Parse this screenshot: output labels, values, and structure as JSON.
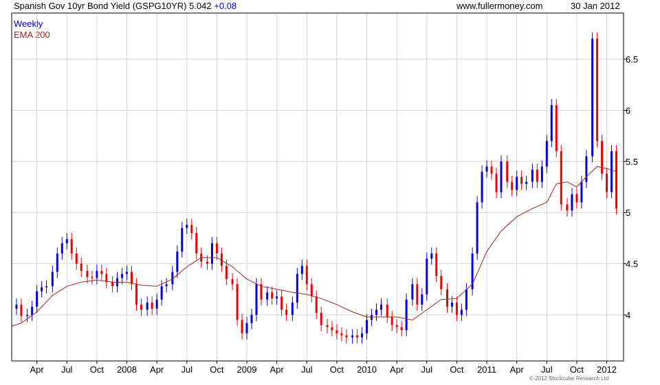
{
  "header": {
    "title": "Spanish Gov 10yr Bond Yield (GSPG10YR) 5.042",
    "change": "+0.08",
    "site": "www.fullermoney.com",
    "date": "30 Jan 2012"
  },
  "legend": {
    "series1": "Weekly",
    "series2": "EMA 200"
  },
  "copyright": "© 2012 Stockcube Research Ltd",
  "colors": {
    "up": "#0000dd",
    "down": "#ee0000",
    "ema": "#aa2222",
    "grid": "#d4d4d4",
    "frame": "#000000"
  },
  "chart_data": {
    "type": "candlestick-bar",
    "title": "Spanish Gov 10yr Bond Yield (GSPG10YR) 5.042 +0.08",
    "xlabel": "",
    "ylabel": "",
    "ylim": [
      3.55,
      6.95
    ],
    "y_ticks": [
      4,
      4.5,
      5,
      5.5,
      6,
      6.5
    ],
    "y_tick_labels": [
      "4",
      "4.5",
      "5",
      "5.5",
      "6",
      "6.5"
    ],
    "x_ticks": [
      {
        "label": "Apr",
        "t": 2007.25
      },
      {
        "label": "Jul",
        "t": 2007.5
      },
      {
        "label": "Oct",
        "t": 2007.75
      },
      {
        "label": "2008",
        "t": 2008.0
      },
      {
        "label": "Apr",
        "t": 2008.25
      },
      {
        "label": "Jul",
        "t": 2008.5
      },
      {
        "label": "Oct",
        "t": 2008.75
      },
      {
        "label": "2009",
        "t": 2009.0
      },
      {
        "label": "Apr",
        "t": 2009.25
      },
      {
        "label": "Jul",
        "t": 2009.5
      },
      {
        "label": "Oct",
        "t": 2009.75
      },
      {
        "label": "2010",
        "t": 2010.0
      },
      {
        "label": "Apr",
        "t": 2010.25
      },
      {
        "label": "Jul",
        "t": 2010.5
      },
      {
        "label": "Oct",
        "t": 2010.75
      },
      {
        "label": "2011",
        "t": 2011.0
      },
      {
        "label": "Apr",
        "t": 2011.25
      },
      {
        "label": "Jul",
        "t": 2011.5
      },
      {
        "label": "Oct",
        "t": 2011.75
      },
      {
        "label": "2012",
        "t": 2012.0
      }
    ],
    "xlim": [
      2007.04,
      2012.14
    ],
    "weekly_close": [
      [
        2007.08,
        4.1
      ],
      [
        2007.12,
        3.99
      ],
      [
        2007.17,
        4.0
      ],
      [
        2007.21,
        4.08
      ],
      [
        2007.25,
        4.23
      ],
      [
        2007.29,
        4.27
      ],
      [
        2007.33,
        4.28
      ],
      [
        2007.38,
        4.42
      ],
      [
        2007.42,
        4.6
      ],
      [
        2007.46,
        4.7
      ],
      [
        2007.5,
        4.74
      ],
      [
        2007.54,
        4.6
      ],
      [
        2007.58,
        4.5
      ],
      [
        2007.62,
        4.43
      ],
      [
        2007.67,
        4.37
      ],
      [
        2007.71,
        4.36
      ],
      [
        2007.75,
        4.43
      ],
      [
        2007.79,
        4.4
      ],
      [
        2007.83,
        4.32
      ],
      [
        2007.88,
        4.28
      ],
      [
        2007.92,
        4.36
      ],
      [
        2007.96,
        4.4
      ],
      [
        2008.0,
        4.42
      ],
      [
        2008.04,
        4.3
      ],
      [
        2008.08,
        4.1
      ],
      [
        2008.12,
        4.05
      ],
      [
        2008.17,
        4.12
      ],
      [
        2008.21,
        4.06
      ],
      [
        2008.25,
        4.15
      ],
      [
        2008.29,
        4.28
      ],
      [
        2008.33,
        4.3
      ],
      [
        2008.38,
        4.42
      ],
      [
        2008.42,
        4.62
      ],
      [
        2008.46,
        4.85
      ],
      [
        2008.5,
        4.88
      ],
      [
        2008.54,
        4.8
      ],
      [
        2008.58,
        4.6
      ],
      [
        2008.62,
        4.52
      ],
      [
        2008.67,
        4.5
      ],
      [
        2008.71,
        4.7
      ],
      [
        2008.75,
        4.6
      ],
      [
        2008.79,
        4.48
      ],
      [
        2008.83,
        4.35
      ],
      [
        2008.88,
        4.3
      ],
      [
        2008.92,
        3.95
      ],
      [
        2008.96,
        3.82
      ],
      [
        2009.0,
        3.92
      ],
      [
        2009.04,
        4.0
      ],
      [
        2009.08,
        4.3
      ],
      [
        2009.12,
        4.15
      ],
      [
        2009.17,
        4.22
      ],
      [
        2009.21,
        4.16
      ],
      [
        2009.25,
        4.18
      ],
      [
        2009.29,
        4.05
      ],
      [
        2009.33,
        4.0
      ],
      [
        2009.38,
        4.12
      ],
      [
        2009.42,
        4.4
      ],
      [
        2009.46,
        4.48
      ],
      [
        2009.5,
        4.3
      ],
      [
        2009.54,
        4.18
      ],
      [
        2009.58,
        4.02
      ],
      [
        2009.62,
        3.9
      ],
      [
        2009.67,
        3.88
      ],
      [
        2009.71,
        3.85
      ],
      [
        2009.75,
        3.82
      ],
      [
        2009.79,
        3.8
      ],
      [
        2009.83,
        3.78
      ],
      [
        2009.88,
        3.8
      ],
      [
        2009.92,
        3.78
      ],
      [
        2009.96,
        3.82
      ],
      [
        2010.0,
        3.95
      ],
      [
        2010.04,
        4.0
      ],
      [
        2010.08,
        4.05
      ],
      [
        2010.12,
        4.1
      ],
      [
        2010.17,
        3.98
      ],
      [
        2010.21,
        3.9
      ],
      [
        2010.25,
        3.88
      ],
      [
        2010.29,
        3.85
      ],
      [
        2010.33,
        4.15
      ],
      [
        2010.38,
        4.3
      ],
      [
        2010.42,
        4.1
      ],
      [
        2010.46,
        4.2
      ],
      [
        2010.5,
        4.55
      ],
      [
        2010.54,
        4.6
      ],
      [
        2010.58,
        4.38
      ],
      [
        2010.62,
        4.25
      ],
      [
        2010.67,
        4.08
      ],
      [
        2010.71,
        4.12
      ],
      [
        2010.75,
        4.0
      ],
      [
        2010.79,
        4.05
      ],
      [
        2010.83,
        4.25
      ],
      [
        2010.88,
        4.6
      ],
      [
        2010.92,
        5.1
      ],
      [
        2010.96,
        5.4
      ],
      [
        2011.0,
        5.45
      ],
      [
        2011.04,
        5.38
      ],
      [
        2011.08,
        5.2
      ],
      [
        2011.12,
        5.5
      ],
      [
        2011.17,
        5.3
      ],
      [
        2011.21,
        5.22
      ],
      [
        2011.25,
        5.35
      ],
      [
        2011.29,
        5.28
      ],
      [
        2011.33,
        5.3
      ],
      [
        2011.38,
        5.42
      ],
      [
        2011.42,
        5.3
      ],
      [
        2011.46,
        5.45
      ],
      [
        2011.5,
        5.7
      ],
      [
        2011.54,
        6.05
      ],
      [
        2011.58,
        5.6
      ],
      [
        2011.62,
        5.08
      ],
      [
        2011.67,
        5.02
      ],
      [
        2011.71,
        5.18
      ],
      [
        2011.75,
        5.1
      ],
      [
        2011.79,
        5.3
      ],
      [
        2011.83,
        5.55
      ],
      [
        2011.88,
        6.7
      ],
      [
        2011.92,
        5.7
      ],
      [
        2011.96,
        5.38
      ],
      [
        2012.0,
        5.2
      ],
      [
        2012.04,
        5.6
      ],
      [
        2012.08,
        5.04
      ]
    ],
    "ema200": [
      [
        2007.04,
        3.89
      ],
      [
        2007.12,
        3.92
      ],
      [
        2007.25,
        4.03
      ],
      [
        2007.38,
        4.19
      ],
      [
        2007.5,
        4.28
      ],
      [
        2007.62,
        4.32
      ],
      [
        2007.75,
        4.34
      ],
      [
        2007.88,
        4.32
      ],
      [
        2008.0,
        4.32
      ],
      [
        2008.12,
        4.29
      ],
      [
        2008.25,
        4.28
      ],
      [
        2008.38,
        4.35
      ],
      [
        2008.5,
        4.47
      ],
      [
        2008.62,
        4.56
      ],
      [
        2008.75,
        4.56
      ],
      [
        2008.88,
        4.47
      ],
      [
        2009.0,
        4.35
      ],
      [
        2009.12,
        4.28
      ],
      [
        2009.25,
        4.25
      ],
      [
        2009.38,
        4.22
      ],
      [
        2009.5,
        4.2
      ],
      [
        2009.62,
        4.16
      ],
      [
        2009.75,
        4.1
      ],
      [
        2009.88,
        4.03
      ],
      [
        2010.0,
        3.98
      ],
      [
        2010.12,
        3.98
      ],
      [
        2010.25,
        3.98
      ],
      [
        2010.38,
        3.95
      ],
      [
        2010.5,
        4.05
      ],
      [
        2010.62,
        4.15
      ],
      [
        2010.75,
        4.16
      ],
      [
        2010.88,
        4.3
      ],
      [
        2011.0,
        4.62
      ],
      [
        2011.12,
        4.82
      ],
      [
        2011.25,
        4.96
      ],
      [
        2011.38,
        5.04
      ],
      [
        2011.5,
        5.1
      ],
      [
        2011.58,
        5.28
      ],
      [
        2011.67,
        5.3
      ],
      [
        2011.75,
        5.25
      ],
      [
        2011.83,
        5.35
      ],
      [
        2011.92,
        5.45
      ],
      [
        2012.0,
        5.43
      ],
      [
        2012.08,
        5.4
      ]
    ]
  }
}
